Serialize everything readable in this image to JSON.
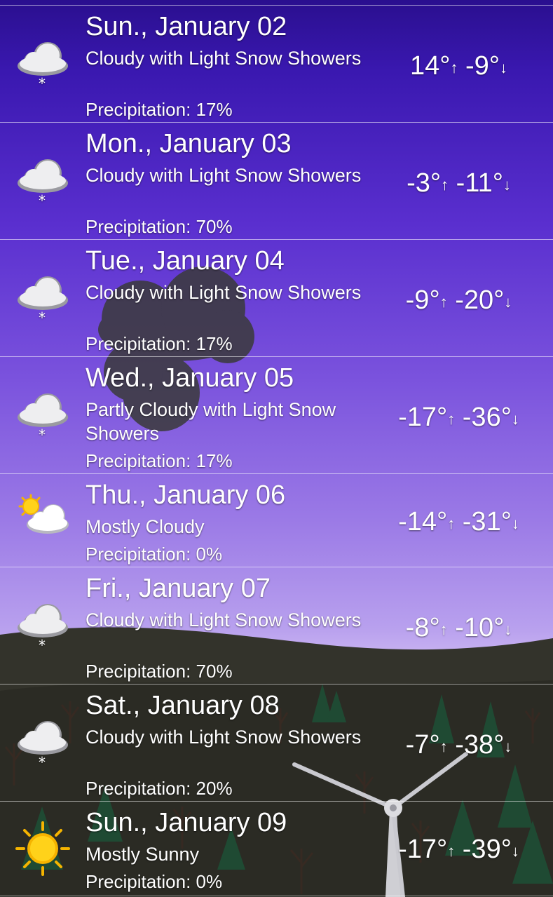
{
  "days": [
    {
      "date": "Sun., January 02",
      "condition": "Cloudy with Light Snow Showers",
      "precipitation": "Precipitation: 17%",
      "high": "14°",
      "low": "-9°",
      "icon": "cloud-snow-icon"
    },
    {
      "date": "Mon., January 03",
      "condition": "Cloudy with Light Snow Showers",
      "precipitation": "Precipitation: 70%",
      "high": "-3°",
      "low": "-11°",
      "icon": "cloud-snow-icon"
    },
    {
      "date": "Tue., January 04",
      "condition": "Cloudy with Light Snow Showers",
      "precipitation": "Precipitation: 17%",
      "high": "-9°",
      "low": "-20°",
      "icon": "cloud-snow-icon"
    },
    {
      "date": "Wed., January 05",
      "condition": "Partly Cloudy with Light Snow Showers",
      "precipitation": "Precipitation: 17%",
      "high": "-17°",
      "low": "-36°",
      "icon": "cloud-snow-icon"
    },
    {
      "date": "Thu., January 06",
      "condition": "Mostly Cloudy",
      "precipitation": "Precipitation: 0%",
      "high": "-14°",
      "low": "-31°",
      "icon": "sun-cloud-icon"
    },
    {
      "date": "Fri., January 07",
      "condition": "Cloudy with Light Snow Showers",
      "precipitation": "Precipitation: 70%",
      "high": "-8°",
      "low": "-10°",
      "icon": "cloud-snow-icon"
    },
    {
      "date": "Sat., January 08",
      "condition": "Cloudy with Light Snow Showers",
      "precipitation": "Precipitation: 20%",
      "high": "-7°",
      "low": "-38°",
      "icon": "cloud-snow-icon"
    },
    {
      "date": "Sun., January 09",
      "condition": "Mostly Sunny",
      "precipitation": "Precipitation: 0%",
      "high": "-17°",
      "low": "-39°",
      "icon": "sun-icon"
    }
  ],
  "arrows": {
    "up": "↑",
    "down": "↓"
  },
  "colors": {
    "sky_top": "#2a0f8f",
    "sky_bottom": "#cdb8f2",
    "ground": "#2f2f28",
    "text": "#ffffff"
  }
}
